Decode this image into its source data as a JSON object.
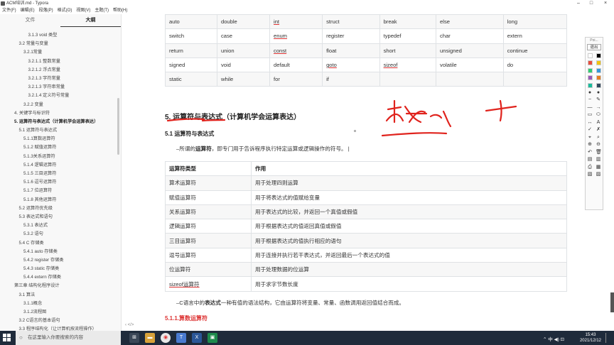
{
  "window": {
    "title": "ACM培训.md - Typora",
    "controls": [
      "–",
      "□",
      "×"
    ]
  },
  "menu": [
    "文件(F)",
    "编辑(E)",
    "段落(P)",
    "格式(O)",
    "视图(V)",
    "主题(T)",
    "帮助(H)"
  ],
  "sidebar": {
    "tabs": [
      "文件",
      "大纲"
    ],
    "outline": [
      {
        "label": "3.1.3 void 类型",
        "level": 3
      },
      {
        "label": "3.2 常量与变量",
        "level": 1
      },
      {
        "label": "3.2.1常量",
        "level": 2
      },
      {
        "label": "3.2.1.1 整数常量",
        "level": 3
      },
      {
        "label": "3.2.1.2 浮点常量",
        "level": 3
      },
      {
        "label": "3.2.1.3 字符常量",
        "level": 3
      },
      {
        "label": "3.2.1.3 字符串常量",
        "level": 3
      },
      {
        "label": "3.2.1.4 定义符号常量",
        "level": 3
      },
      {
        "label": "3.2.2 变量",
        "level": 2
      },
      {
        "label": "4. 关键字与标识符",
        "level": 0
      },
      {
        "label": "5. 运算符与表达式（计算机学会运算表达）",
        "level": 0,
        "active": true
      },
      {
        "label": "5.1 运算符与表达式",
        "level": 1
      },
      {
        "label": "5.1.1算数运算符",
        "level": 2
      },
      {
        "label": "5.1.2 赋值运算符",
        "level": 2
      },
      {
        "label": "5.1.3关系运算符",
        "level": 2
      },
      {
        "label": "5.1.4 逻辑运算符",
        "level": 2
      },
      {
        "label": "5.1.5 三目运算符",
        "level": 2
      },
      {
        "label": "5.1.6 逗号运算符",
        "level": 2
      },
      {
        "label": "5.1.7 位运算符",
        "level": 2
      },
      {
        "label": "5.1.8 其他运算符",
        "level": 2
      },
      {
        "label": "5.2 运算符优先级",
        "level": 1
      },
      {
        "label": "5.3 表达式和语句",
        "level": 1
      },
      {
        "label": "5.3.1 表达式",
        "level": 2
      },
      {
        "label": "5.3.2 语句",
        "level": 2
      },
      {
        "label": "5.4 C 存储类",
        "level": 1
      },
      {
        "label": "5.4.1 auto 存储类",
        "level": 2
      },
      {
        "label": "5.4.2 register 存储类",
        "level": 2
      },
      {
        "label": "5.4.3 static 存储类",
        "level": 2
      },
      {
        "label": "5.4.4 extern 存储类",
        "level": 2
      },
      {
        "label": "第三章 结构化程序设计",
        "level": 0
      },
      {
        "label": "3.1 算法",
        "level": 1
      },
      {
        "label": "3.1.1概念",
        "level": 2
      },
      {
        "label": "3.1.2流程图",
        "level": 2
      },
      {
        "label": "3.2 C语言的基本语句",
        "level": 1
      },
      {
        "label": "3.3 程序结构化（让计算机按流程操作）",
        "level": 1
      }
    ],
    "footer": "‹  </>"
  },
  "keywords_table": [
    [
      "auto",
      "double",
      "int",
      "struct",
      "break",
      "else",
      "long"
    ],
    [
      "switch",
      "case",
      "enum",
      "register",
      "typedef",
      "char",
      "extern"
    ],
    [
      "return",
      "union",
      "const",
      "float",
      "short",
      "unsigned",
      "continue"
    ],
    [
      "signed",
      "void",
      "default",
      "goto",
      "sizeof",
      "volatile",
      "do"
    ],
    [
      "static",
      "while",
      "for",
      "if",
      "",
      "",
      ""
    ]
  ],
  "underlined_keywords": [
    "int",
    "enum",
    "const",
    "goto",
    "sizeof"
  ],
  "heading": "5. 运算符与表达式（计算机学会运算表达）",
  "subheading": "5.1 运算符与表达式",
  "paragraph1": {
    "prefix": "–所谓的",
    "bold": "运算符",
    "suffix": "，即专门用于告诉程序执行特定运算或逻辑操作的符号。"
  },
  "ops_table": {
    "headers": [
      "运算符类型",
      "作用"
    ],
    "rows": [
      [
        "算术运算符",
        "用于处理四则运算"
      ],
      [
        "赋值运算符",
        "用于将表达式的值赋给变量"
      ],
      [
        "关系运算符",
        "用于表达式的比较，并返回一个真值或假值"
      ],
      [
        "逻辑运算符",
        "用于根据表达式的值返回真值或假值"
      ],
      [
        "三目运算符",
        "用于根据表达式的值执行相应的语句"
      ],
      [
        "逗号运算符",
        "用于连接并执行若干表达式，并返回最后一个表达式的值"
      ],
      [
        "位运算符",
        "用于处理数据的位运算"
      ],
      [
        "sizeof运算符",
        "用于求字节数长度"
      ]
    ]
  },
  "paragraph2": {
    "prefix": "–C语言中的",
    "bold": "表达式",
    "suffix": "一种有值的语法结构，它由运算符将变量、常量、函数调用返回值结合而成。"
  },
  "heading4": "5.1.1.算数运算符",
  "pen_toolbar": {
    "header": "Poi...",
    "label": "退出",
    "colors": [
      "#ffffff",
      "#000000",
      "#e74c3c",
      "#f1c40f",
      "#2ecc71",
      "#3498db",
      "#9b59b6",
      "#e67e22",
      "#1abc9c",
      "#34495e"
    ]
  },
  "taskbar": {
    "search_placeholder": "在这里输入你要搜索的内容",
    "tray": "⌃  中  ◀)  ⊡",
    "time": "15:43",
    "date": "2021/12/12"
  },
  "accent": "#d33"
}
